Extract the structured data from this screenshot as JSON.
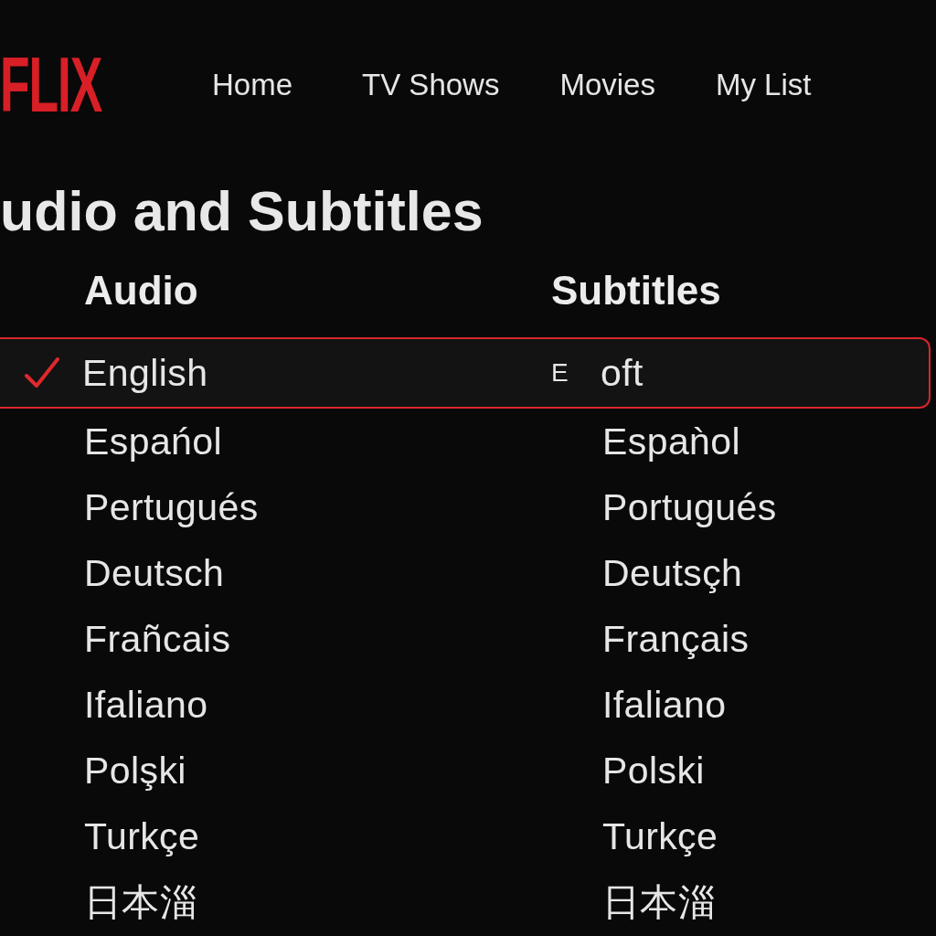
{
  "header": {
    "logo": "FLIX",
    "nav": [
      {
        "label": "Home"
      },
      {
        "label": "TV Shows"
      },
      {
        "label": "Movies"
      },
      {
        "label": "My List"
      }
    ]
  },
  "page_title": "udio and Subtitles",
  "columns": [
    {
      "heading": "Audio"
    },
    {
      "heading": "Subtitles"
    }
  ],
  "rows": [
    {
      "selected": true,
      "audio": {
        "label": "English",
        "checked": true
      },
      "subtitle": {
        "marker": "E",
        "label": "oft"
      }
    },
    {
      "selected": false,
      "audio": {
        "label": "Espańol",
        "checked": false
      },
      "subtitle": {
        "label": "Espaǹol"
      }
    },
    {
      "selected": false,
      "audio": {
        "label": "Pertugués",
        "checked": false
      },
      "subtitle": {
        "label": "Portugués"
      }
    },
    {
      "selected": false,
      "audio": {
        "label": "Deutsch",
        "checked": false
      },
      "subtitle": {
        "label": "Deutsçh"
      }
    },
    {
      "selected": false,
      "audio": {
        "label": "Frañcais",
        "checked": false
      },
      "subtitle": {
        "label": "Français"
      }
    },
    {
      "selected": false,
      "audio": {
        "label": "Ifaliano",
        "checked": false
      },
      "subtitle": {
        "label": "Ifaliano"
      }
    },
    {
      "selected": false,
      "audio": {
        "label": "Polşki",
        "checked": false
      },
      "subtitle": {
        "label": "Polski"
      }
    },
    {
      "selected": false,
      "audio": {
        "label": "Turkçe",
        "checked": false
      },
      "subtitle": {
        "label": "Turkçe"
      }
    },
    {
      "selected": false,
      "audio": {
        "label": "日本淄",
        "checked": false
      },
      "subtitle": {
        "label": "日本淄"
      }
    }
  ]
}
